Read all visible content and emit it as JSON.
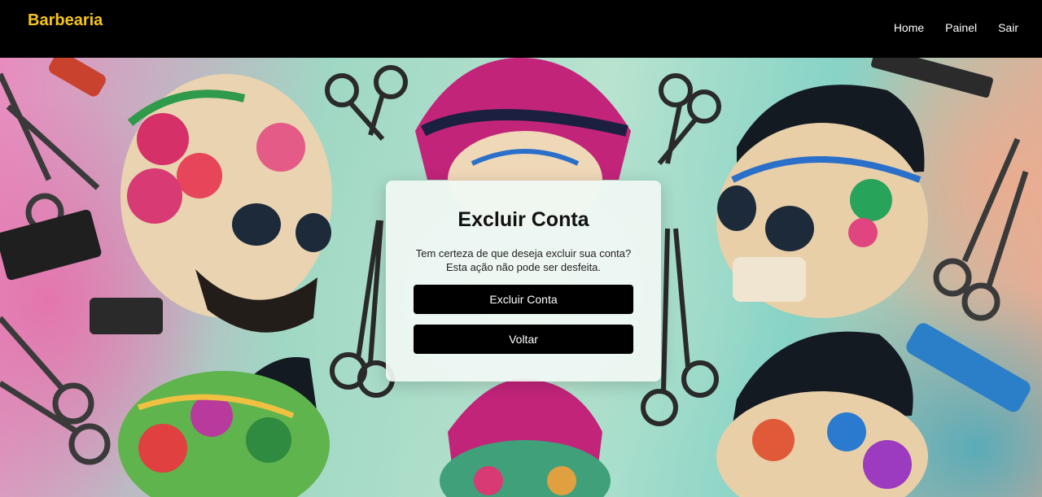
{
  "navbar": {
    "brand": "Barbearia",
    "links": [
      {
        "label": "Home"
      },
      {
        "label": "Painel"
      },
      {
        "label": "Sair"
      }
    ]
  },
  "hero": {
    "background_icons": [
      "skull-icon",
      "scissors-icon",
      "comb-icon",
      "razor-icon"
    ]
  },
  "modal": {
    "title": "Excluir Conta",
    "message": "Tem certeza de que deseja excluir sua conta? Esta ação não pode ser desfeita.",
    "confirm_label": "Excluir Conta",
    "back_label": "Voltar"
  },
  "colors": {
    "brand": "#f5c518",
    "navbar_bg": "#000000",
    "button_bg": "#000000",
    "button_text": "#ffffff"
  }
}
